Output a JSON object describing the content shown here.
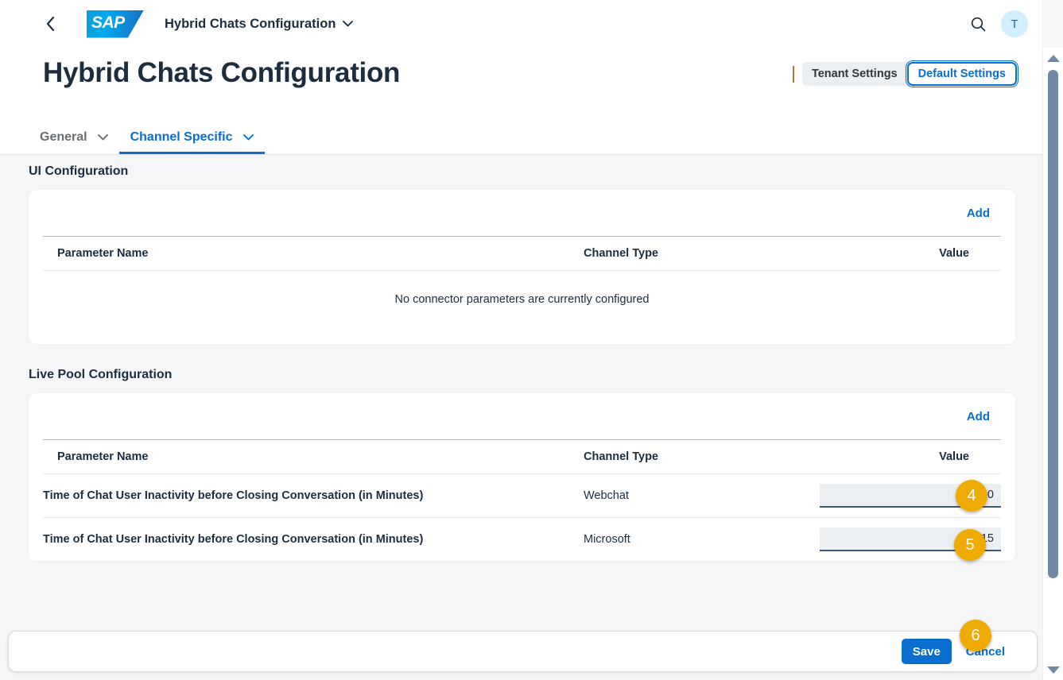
{
  "shell": {
    "back_icon": "chevron-left-icon",
    "logo_text": "SAP",
    "app_title": "Hybrid Chats Configuration",
    "title_chevron": "chevron-down-icon",
    "search_icon": "search-icon",
    "avatar_initial": "T"
  },
  "header": {
    "page_title": "Hybrid Chats Configuration",
    "settings_scope": {
      "options": [
        "Tenant Settings",
        "Default Settings"
      ],
      "selected": "Default Settings"
    }
  },
  "tabs": [
    {
      "label": "General",
      "active": false,
      "chevron": "chevron-down-icon"
    },
    {
      "label": "Channel Specific",
      "active": true,
      "chevron": "chevron-down-icon"
    }
  ],
  "sections": [
    {
      "title": "UI Configuration",
      "add_label": "Add",
      "columns": [
        "Parameter Name",
        "Channel Type",
        "Value"
      ],
      "empty_message": "No connector parameters are currently configured",
      "rows": []
    },
    {
      "title": "Live Pool Configuration",
      "add_label": "Add",
      "columns": [
        "Parameter Name",
        "Channel Type",
        "Value"
      ],
      "empty_message": "",
      "rows": [
        {
          "parameter": "Time of Chat User Inactivity before Closing Conversation (in Minutes)",
          "channel": "Webchat",
          "value": "10"
        },
        {
          "parameter": "Time of Chat User Inactivity before Closing Conversation (in Minutes)",
          "channel": "Microsoft",
          "value": "15"
        }
      ]
    }
  ],
  "footer": {
    "save_label": "Save",
    "cancel_label": "Cancel"
  },
  "annotations": [
    {
      "number": "4"
    },
    {
      "number": "5"
    },
    {
      "number": "6"
    }
  ],
  "colors": {
    "accent_blue": "#0a6ed1",
    "badge_orange": "#f0ab00",
    "text_dark": "#1d2d3e",
    "page_bg": "#f5f6f7"
  }
}
